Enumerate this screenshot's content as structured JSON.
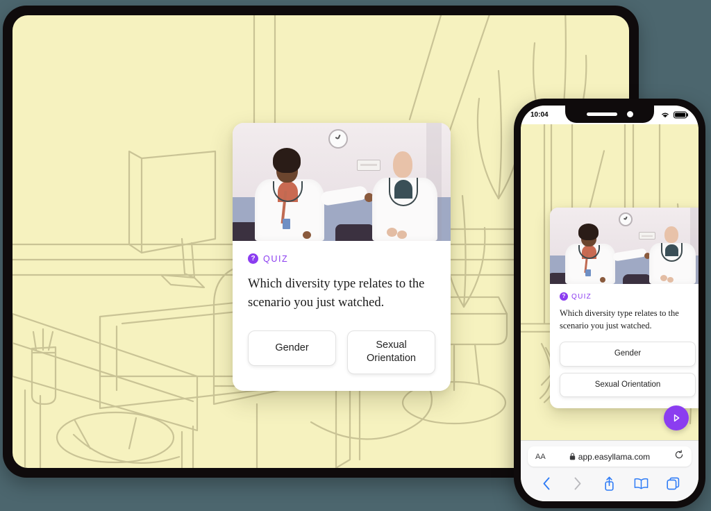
{
  "page": {
    "background_color": "#4c666e",
    "brand_purple": "#8b3df0",
    "screen_background": "#f6f2bf",
    "illustration_stroke": "#c9c395"
  },
  "tablet": {
    "device_name": "tablet-device",
    "quiz_card": {
      "tag_icon": "question-mark-badge-icon",
      "tag_label": "QUIZ",
      "question": "Which diversity type relates to the scenario you just watched.",
      "answers": [
        {
          "label": "Gender"
        },
        {
          "label": "Sexual Orientation"
        }
      ],
      "video": {
        "alt": "Two doctors in white lab coats talking in a clinic examination room with a wall clock"
      }
    }
  },
  "phone": {
    "device_name": "phone-device",
    "status_bar": {
      "time": "10:04",
      "wifi_icon": "wifi-icon",
      "battery_icon": "battery-icon"
    },
    "quiz_card": {
      "tag_icon": "question-mark-badge-icon",
      "tag_label": "QUIZ",
      "question": "Which diversity type relates to the scenario you just watched.",
      "answers": [
        {
          "label": "Gender"
        },
        {
          "label": "Sexual Orientation"
        }
      ],
      "video": {
        "alt": "Two doctors in white lab coats talking in a clinic examination room with a wall clock"
      }
    },
    "fab": {
      "icon": "play-triangle-icon",
      "color": "#8b3df0"
    },
    "browser": {
      "text_size_button": "AA",
      "lock_icon": "lock-icon",
      "url": "app.easyllama.com",
      "reload_icon": "reload-icon",
      "toolbar": [
        {
          "icon": "back-chevron-icon",
          "enabled": true
        },
        {
          "icon": "forward-chevron-icon",
          "enabled": false
        },
        {
          "icon": "share-icon",
          "enabled": true
        },
        {
          "icon": "bookmarks-book-icon",
          "enabled": true
        },
        {
          "icon": "tabs-icon",
          "enabled": true
        }
      ]
    }
  }
}
